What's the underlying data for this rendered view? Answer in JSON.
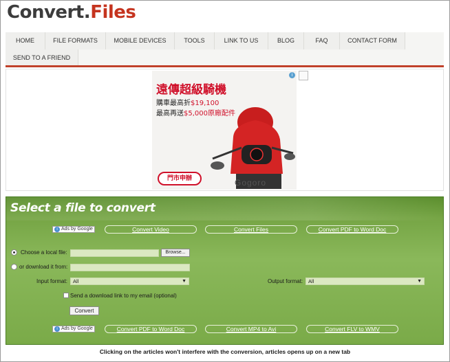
{
  "logo": {
    "part1": "Convert",
    "dot": ".",
    "part2": "Files"
  },
  "nav": {
    "items": [
      "HOME",
      "FILE FORMATS",
      "MOBILE DEVICES",
      "TOOLS",
      "LINK TO US",
      "BLOG",
      "FAQ",
      "CONTACT FORM",
      "SEND TO A FRIEND"
    ]
  },
  "ad": {
    "headline": "遠傳超級騎機",
    "line1_a": "購車最高折",
    "line1_b": "$19,100",
    "line2_a": "最高再送",
    "line2_b": "$5,000原廠配件",
    "cta": "門市申辦",
    "brand": "Gogoro"
  },
  "panel": {
    "title": "Select a file to convert",
    "ads_by": "Ads by Google",
    "top_links": [
      "Convert Video",
      "Convert Files",
      "Convert PDF to Word Doc"
    ],
    "bottom_links": [
      "Convert PDF to Word Doc",
      "Convert MP4 to Avi",
      "Convert FLV to WMV"
    ],
    "local_file_label": "Choose a local file:",
    "download_label": "or download it from:",
    "browse": "Browse...",
    "input_format_label": "Input format:",
    "input_format_value": "All",
    "output_format_label": "Output format:",
    "output_format_value": "All",
    "email_label": "Send a download link to my email (optional)",
    "convert": "Convert"
  },
  "footer": "Clicking on the articles won't interfere with the conversion, articles opens up on a new tab",
  "colors": {
    "accent_red": "#c0412a",
    "panel_green": "#7aaa48"
  }
}
